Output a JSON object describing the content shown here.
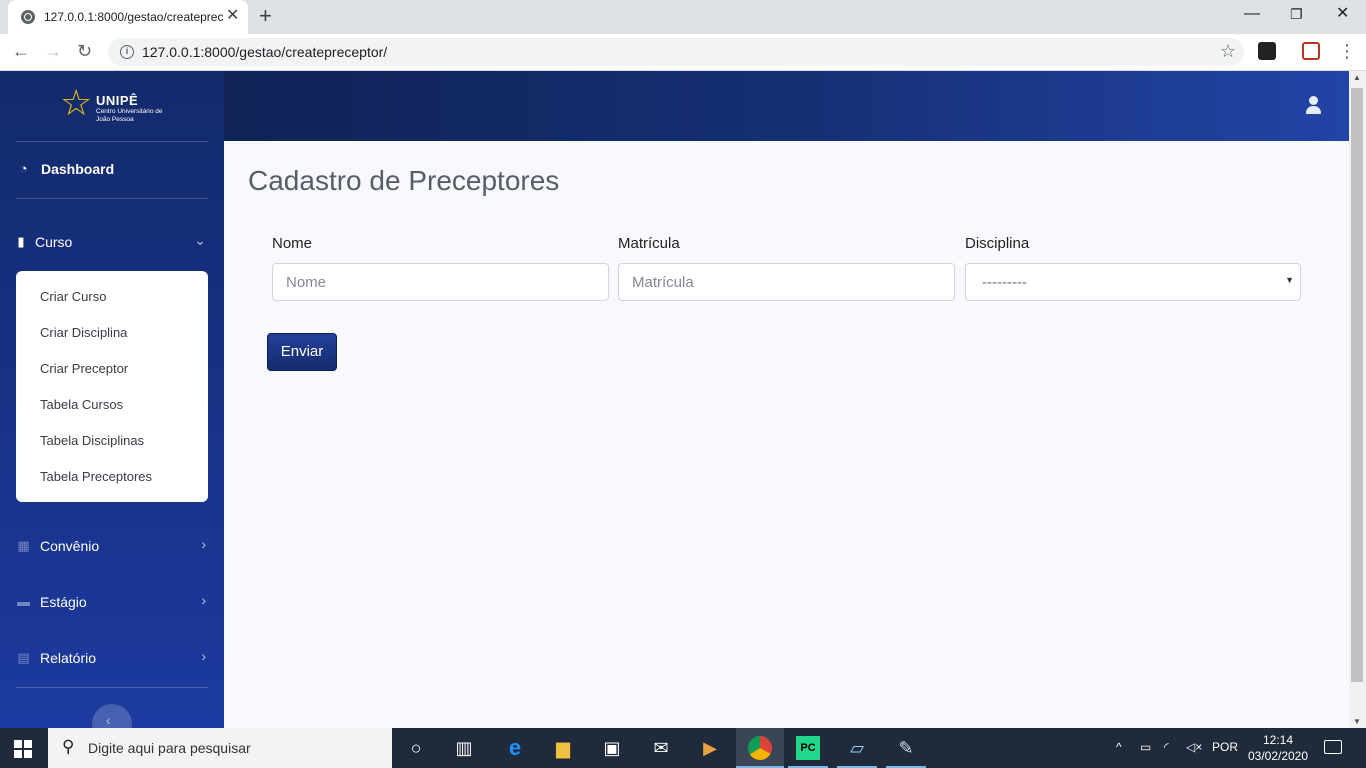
{
  "browser": {
    "tab_title": "127.0.0.1:8000/gestao/createpreceptor/",
    "url": "127.0.0.1:8000/gestao/createpreceptor/"
  },
  "logo": {
    "name": "UNIPÊ",
    "subtitle": "Centro Universitário de João Pessoa"
  },
  "sidebar": {
    "dashboard": "Dashboard",
    "curso": "Curso",
    "curso_items": [
      "Criar Curso",
      "Criar Disciplina",
      "Criar Preceptor",
      "Tabela Cursos",
      "Tabela Disciplinas",
      "Tabela Preceptores"
    ],
    "convenio": "Convênio",
    "estagio": "Estágio",
    "relatorio": "Relatório"
  },
  "form": {
    "title": "Cadastro de Preceptores",
    "nome_label": "Nome",
    "nome_placeholder": "Nome",
    "matricula_label": "Matrícula",
    "matricula_placeholder": "Matrícula",
    "disciplina_label": "Disciplina",
    "disciplina_selected": "---------",
    "submit": "Enviar"
  },
  "taskbar": {
    "search_placeholder": "Digite aqui para pesquisar",
    "language": "POR",
    "time": "12:14",
    "date": "03/02/2020"
  },
  "colors": {
    "brand_dark": "#132a6b",
    "brand": "#1c3aa0",
    "logo_star": "#f1c40f",
    "page_bg": "#f8f9fc"
  }
}
